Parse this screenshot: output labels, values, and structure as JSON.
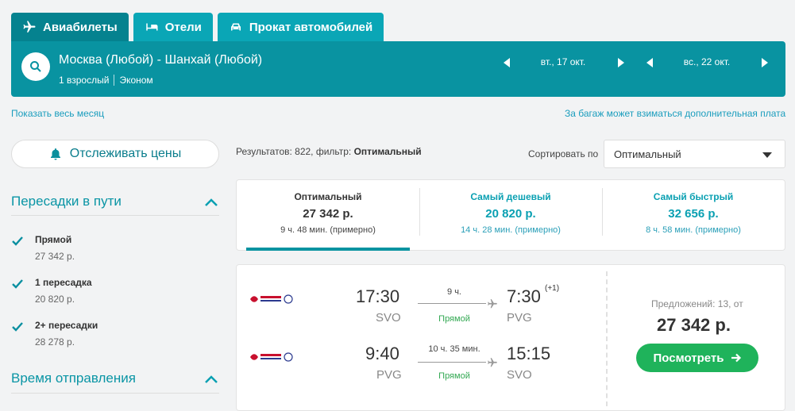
{
  "tabs": [
    {
      "label": "Авиабилеты",
      "icon": "plane-icon"
    },
    {
      "label": "Отели",
      "icon": "bed-icon"
    },
    {
      "label": "Прокат автомобилей",
      "icon": "car-icon"
    }
  ],
  "search": {
    "route": "Москва (Любой) - Шанхай (Любой)",
    "passengers": "1 взрослый",
    "cabin": "Эконом",
    "date_out": "вт., 17 окт.",
    "date_back": "вс., 22 окт."
  },
  "links": {
    "month": "Показать весь месяц",
    "baggage": "За багаж может взиматься дополнительная плата"
  },
  "sidebar": {
    "track_label": "Отслеживать цены",
    "stops_title": "Пересадки в пути",
    "stops": [
      {
        "label": "Прямой",
        "price": "27 342 р."
      },
      {
        "label": "1 пересадка",
        "price": "20 820 р."
      },
      {
        "label": "2+ пересадки",
        "price": "28 278 р."
      }
    ],
    "departure_title": "Время отправления"
  },
  "results": {
    "prefix": "Результатов: 822, фильтр: ",
    "filter": "Оптимальный",
    "sort_label": "Сортировать по",
    "sort_value": "Оптимальный"
  },
  "sort_tabs": [
    {
      "title": "Оптимальный",
      "price": "27 342 р.",
      "duration": "9 ч. 48 мин. (примерно)"
    },
    {
      "title": "Самый дешевый",
      "price": "20 820 р.",
      "duration": "14 ч. 28 мин. (примерно)"
    },
    {
      "title": "Самый быстрый",
      "price": "32 656 р.",
      "duration": "8 ч. 58 мин. (примерно)"
    }
  ],
  "ticket": {
    "legs": [
      {
        "dep_time": "17:30",
        "dep_code": "SVO",
        "duration": "9 ч.",
        "stops": "Прямой",
        "arr_time": "7:30",
        "arr_plus": "(+1)",
        "arr_code": "PVG"
      },
      {
        "dep_time": "9:40",
        "dep_code": "PVG",
        "duration": "10 ч. 35 мин.",
        "stops": "Прямой",
        "arr_time": "15:15",
        "arr_plus": "",
        "arr_code": "SVO"
      }
    ],
    "offers": "Предложений: 13, от",
    "price": "27 342 р.",
    "button": "Посмотреть"
  },
  "colors": {
    "accent": "#0993a1",
    "tab_active": "#05828f",
    "green": "#1fb35b",
    "link": "#1a9dbd"
  }
}
